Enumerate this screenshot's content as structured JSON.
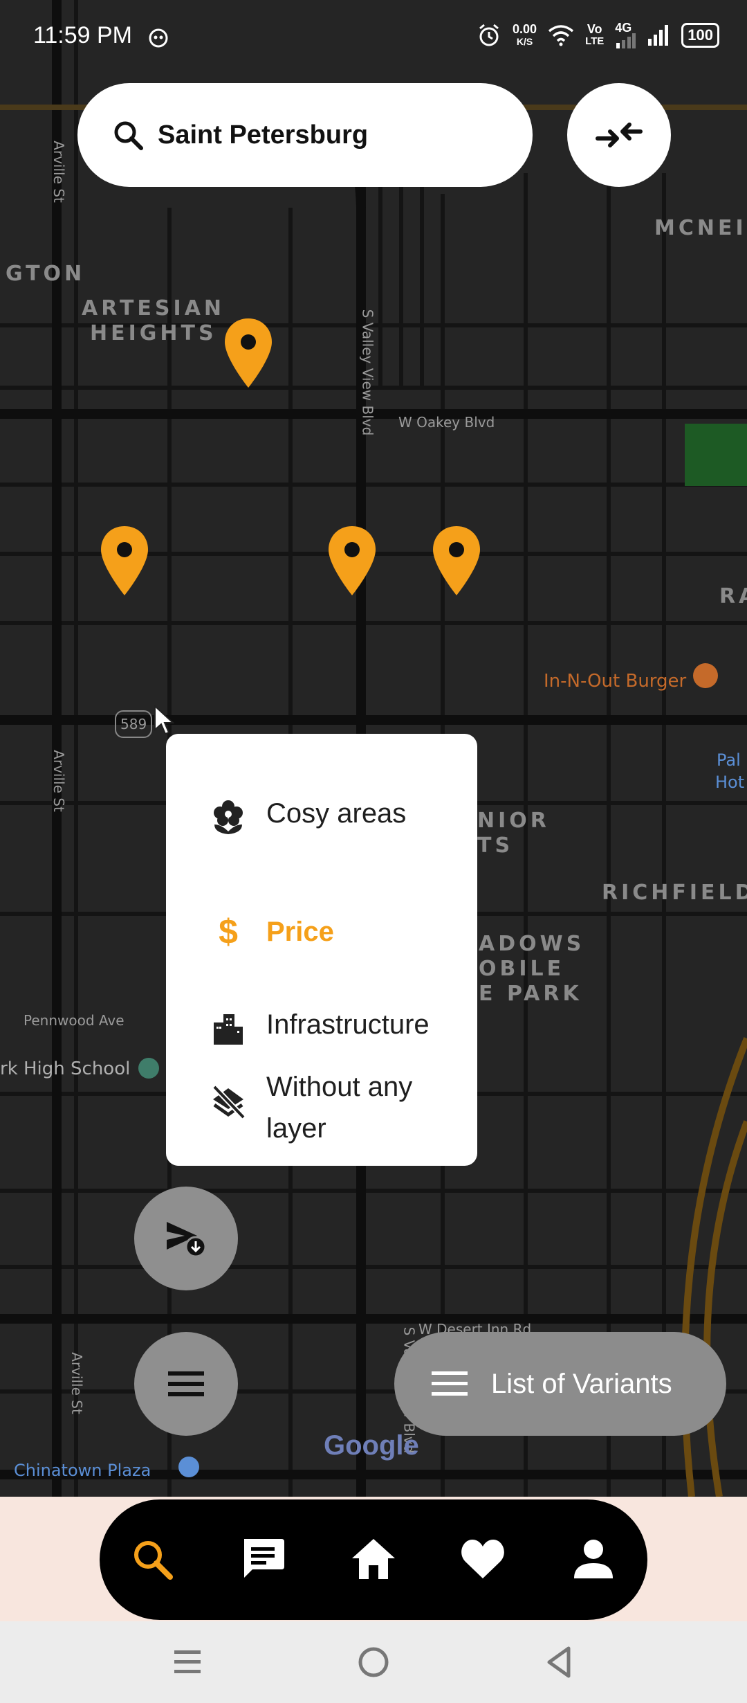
{
  "status_bar": {
    "time": "11:59 PM",
    "net_speed_value": "0.00",
    "net_speed_unit": "K/S",
    "volte_top": "Vo",
    "volte_bottom": "LTE",
    "network_type": "4G",
    "battery": "100"
  },
  "search": {
    "value": "Saint Petersburg"
  },
  "map": {
    "labels": {
      "artesian_1": "ARTESIAN",
      "artesian_2": "HEIGHTS",
      "ington": "GTON",
      "mcnei": "MCNEI",
      "ra": "RA",
      "richfield": "RICHFIELD",
      "nior_1": "NIOR",
      "nior_2": "TS",
      "meadows_1": "ADOWS",
      "meadows_2": "OBILE",
      "meadows_3": "E PARK",
      "oakey": "W Oakey Blvd",
      "valley_top": "S Valley View Blvd",
      "valley_bottom": "S Valley View Blvd",
      "arville_1": "Arville St",
      "arville_2": "Arville St",
      "arville_3": "Arville St",
      "desert_inn": "W Desert Inn Rd",
      "pennwood": "Pennwood Ave",
      "innout": "In-N-Out Burger",
      "high_school": "rk High School",
      "chinatown": "Chinatown Plaza",
      "palm_1": "Pal",
      "palm_2": "Hot",
      "route": "589",
      "google": "Google"
    }
  },
  "layer_menu": {
    "items": [
      {
        "label": "Cosy areas",
        "icon": "flower-icon",
        "active": false
      },
      {
        "label": "Price",
        "icon": "dollar-icon",
        "active": true
      },
      {
        "label": "Infrastructure",
        "icon": "city-buildings-icon",
        "active": false
      },
      {
        "label": "Without any layer",
        "icon": "layers-off-icon",
        "active": false
      }
    ]
  },
  "variants_button": {
    "label": "List of Variants"
  },
  "colors": {
    "accent": "#F5A01A",
    "map_bg": "#252525",
    "fab_gray": "#8F8F8F",
    "nav_bg": "#000000",
    "bottom_bg": "#F8E6DE"
  }
}
